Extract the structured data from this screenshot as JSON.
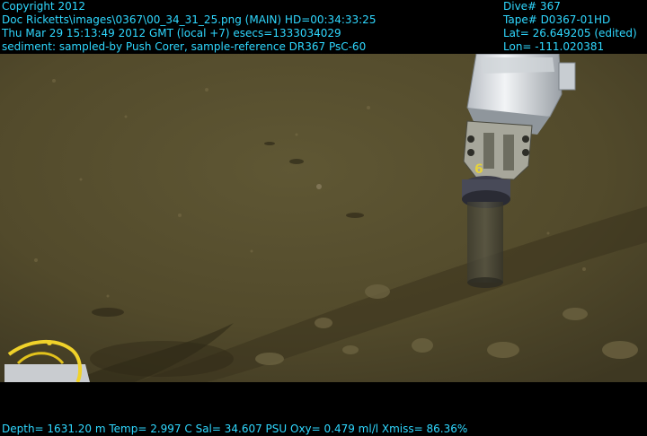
{
  "overlay": {
    "top_left": [
      "Copyright 2012",
      "Doc Ricketts\\images\\0367\\00_34_31_25.png (MAIN)  HD=00:34:33:25",
      "Thu Mar 29 15:13:49 2012 GMT (local +7)  esecs=1333034029",
      "sediment: sampled-by Push Corer, sample-reference DR367 PsC-60"
    ],
    "top_right": [
      "Dive# 367",
      "Tape# D0367-01HD",
      "Lat= 26.649205 (edited)",
      "Lon= -111.020381"
    ],
    "bottom": "Depth= 1631.20 m  Temp= 2.997 C  Sal= 34.607 PSU  Oxy= 0.479 ml/l  Xmiss= 86.36%",
    "text_color": "#2fd8ff"
  },
  "scene": {
    "corer_label": "6",
    "colors": {
      "sediment": "#57502f",
      "sediment_dark": "#3b3520",
      "robot_arm": "#e8ecef",
      "rope": "#f0d22a"
    }
  }
}
